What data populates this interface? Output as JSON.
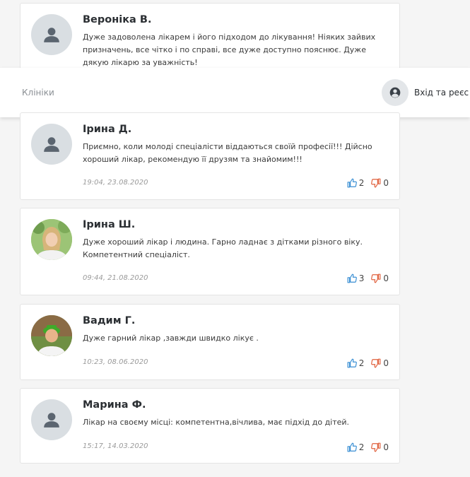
{
  "header": {
    "clinics_link": "Клініки",
    "login_label": "Вхід та реєс"
  },
  "reviews": [
    {
      "name": "Вероніка В.",
      "text": "Дуже задоволена лікарем і його підходом до лікування! Ніяких зайвих призначень, все чітко і по справі, все дуже доступно пояснює. Дуже дякую лікарю за уважність!",
      "avatar": "default"
    },
    {
      "name": "Ірина Д.",
      "text": "Приємно, коли молоді спеціалісти віддаються своїй професії!!! Дійсно хороший лікар, рекомендую її друзям та знайомим!!!",
      "date": "19:04, 23.08.2020",
      "likes": "2",
      "dislikes": "0",
      "avatar": "default"
    },
    {
      "name": "Ірина Ш.",
      "text": "Дуже хороший лікар і людина. Гарно ладнає з дітками різного віку. Компетентний спеціаліст.",
      "date": "09:44, 21.08.2020",
      "likes": "3",
      "dislikes": "0",
      "avatar": "photo-woman"
    },
    {
      "name": "Вадим Г.",
      "text": "Дуже гарний лікар ,завжди швидко лікує .",
      "date": "10:23, 08.06.2020",
      "likes": "2",
      "dislikes": "0",
      "avatar": "photo-child"
    },
    {
      "name": "Марина Ф.",
      "text": "Лікар на своєму місці: компетентна,вічлива, має підхід до дітей.",
      "date": "15:17, 14.03.2020",
      "likes": "2",
      "dislikes": "0",
      "avatar": "default"
    }
  ],
  "colors": {
    "like": "#3a8fd4",
    "dislike": "#e0603c",
    "avatar_bg": "#d9dee2",
    "avatar_icon": "#5b6570"
  },
  "icons": {
    "like": "thumbs-up-icon",
    "dislike": "thumbs-down-icon",
    "user": "user-icon",
    "account": "account-circle-icon"
  }
}
